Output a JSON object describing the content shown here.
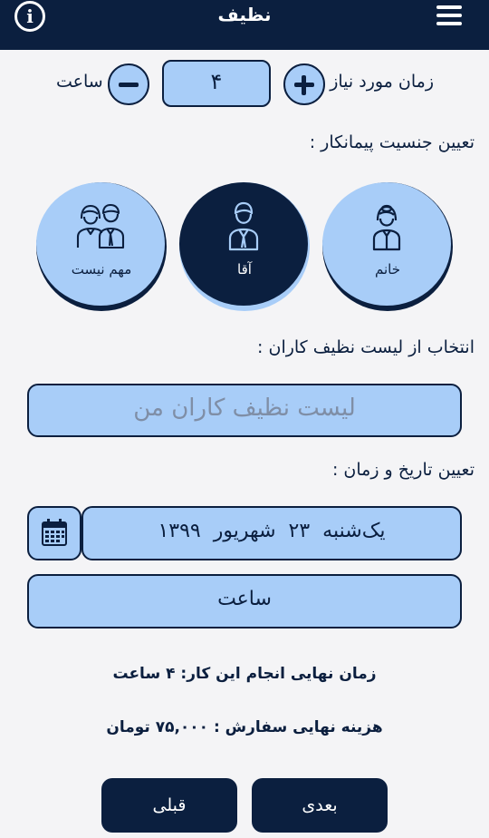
{
  "header": {
    "title": "نظیف",
    "menu_icon": "hamburger-menu-icon",
    "info_icon": "info-icon",
    "info_glyph": "i"
  },
  "hours": {
    "label": "زمان مورد نیاز",
    "unit": "ساعت",
    "value": "۴",
    "plus_icon": "plus-icon",
    "minus_icon": "minus-icon"
  },
  "gender": {
    "label": "تعیین جنسیت پیمانکار :",
    "options": [
      {
        "label": "خانم",
        "icon": "woman-icon",
        "selected": false
      },
      {
        "label": "آقا",
        "icon": "man-icon",
        "selected": true
      },
      {
        "label": "مهم نیست",
        "icon": "couple-icon",
        "selected": false
      }
    ]
  },
  "cleaner_list": {
    "label": "انتخاب از لیست نظیف کاران :",
    "button": "لیست نظیف کاران من"
  },
  "datetime": {
    "label": "تعیین تاریخ و زمان :",
    "date": "یک‌شنبه  ۲۳  شهریور  ۱۳۹۹",
    "time_button": "ساعت",
    "calendar_icon": "calendar-icon"
  },
  "summary": {
    "final_time": "زمان نهایی انجام این کار: ۴ ساعت",
    "final_cost": "هزینه نهایی سفارش : ۷۵,۰۰۰ تومان"
  },
  "nav": {
    "next": "بعدی",
    "prev": "قبلی"
  },
  "colors": {
    "primary": "#0b1f3f",
    "accent": "#a8cdf8",
    "background": "#f4f4f6"
  }
}
